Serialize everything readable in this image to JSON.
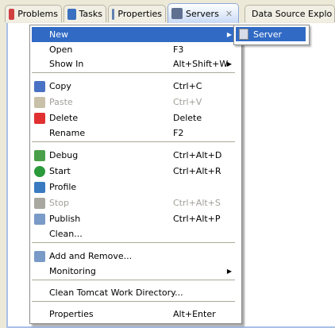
{
  "tabs": [
    {
      "label": "Problems",
      "icon": "problems-icon"
    },
    {
      "label": "Tasks",
      "icon": "tasks-icon"
    },
    {
      "label": "Properties",
      "icon": "properties-icon"
    },
    {
      "label": "Servers",
      "icon": "servers-icon",
      "active": true
    },
    {
      "label": "Data Source Explo",
      "icon": "data-source-icon"
    }
  ],
  "menu": [
    {
      "label": "New",
      "shortcut": "",
      "submenu": true,
      "highlighted": true
    },
    {
      "label": "Open",
      "shortcut": "F3"
    },
    {
      "label": "Show In",
      "shortcut": "Alt+Shift+W",
      "submenu": true
    },
    {
      "sep": true
    },
    {
      "label": "Copy",
      "shortcut": "Ctrl+C",
      "icon": "copy-icon",
      "color": "#4a72c4"
    },
    {
      "label": "Paste",
      "shortcut": "Ctrl+V",
      "icon": "paste-icon",
      "color": "#c8c0a8",
      "disabled": true
    },
    {
      "label": "Delete",
      "shortcut": "Delete",
      "icon": "delete-icon",
      "color": "#e03030"
    },
    {
      "label": "Rename",
      "shortcut": "F2"
    },
    {
      "sep": true
    },
    {
      "label": "Debug",
      "shortcut": "Ctrl+Alt+D",
      "icon": "debug-icon",
      "color": "#4aa04a"
    },
    {
      "label": "Start",
      "shortcut": "Ctrl+Alt+R",
      "icon": "start-icon",
      "color": "#2a9a3a"
    },
    {
      "label": "Profile",
      "shortcut": "",
      "icon": "profile-icon",
      "color": "#3a7ac0"
    },
    {
      "label": "Stop",
      "shortcut": "Ctrl+Alt+S",
      "icon": "stop-icon",
      "color": "#a8a8a0",
      "disabled": true
    },
    {
      "label": "Publish",
      "shortcut": "Ctrl+Alt+P",
      "icon": "publish-icon",
      "color": "#7a9ac8"
    },
    {
      "label": "Clean...",
      "shortcut": ""
    },
    {
      "sep": true
    },
    {
      "label": "Add and Remove...",
      "shortcut": "",
      "icon": "add-remove-icon",
      "color": "#7a9ac8"
    },
    {
      "label": "Monitoring",
      "shortcut": "",
      "submenu": true
    },
    {
      "sep": true
    },
    {
      "label": "Clean Tomcat Work Directory...",
      "shortcut": ""
    },
    {
      "sep": true
    },
    {
      "label": "Properties",
      "shortcut": "Alt+Enter"
    }
  ],
  "submenu": {
    "label": "Server",
    "icon": "new-server-icon"
  },
  "arrow": "▶"
}
